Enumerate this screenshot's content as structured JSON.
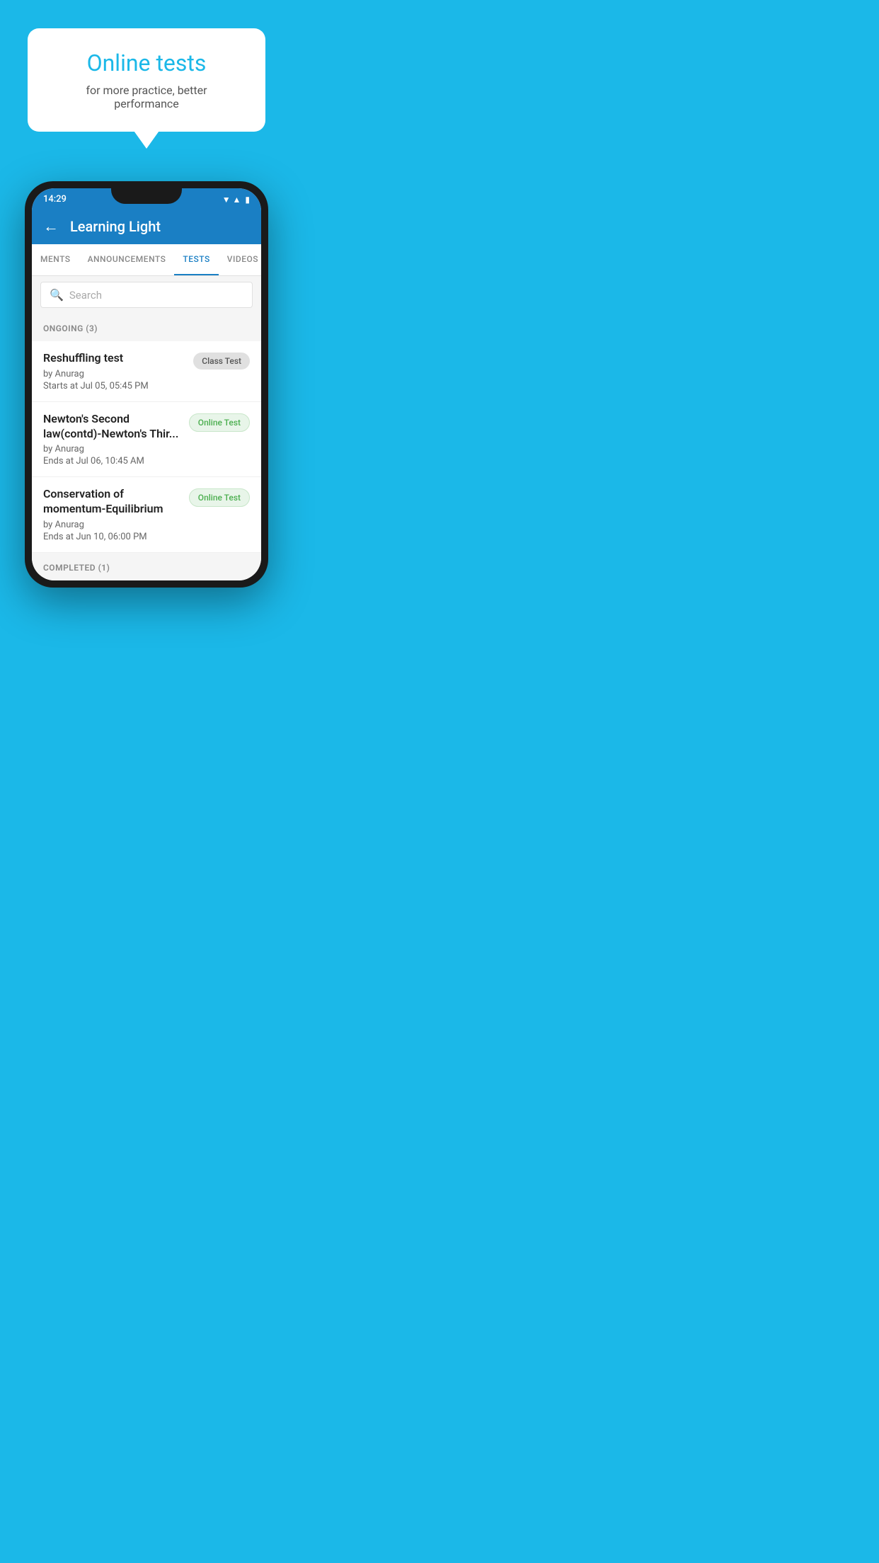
{
  "page": {
    "background_color": "#1BB8E8"
  },
  "bubble": {
    "title": "Online tests",
    "subtitle": "for more practice, better performance"
  },
  "phone": {
    "status_bar": {
      "time": "14:29",
      "wifi": "▲",
      "signal": "▲",
      "battery": "▮"
    },
    "app_bar": {
      "title": "Learning Light",
      "back_label": "←"
    },
    "tabs": [
      {
        "label": "MENTS",
        "active": false
      },
      {
        "label": "ANNOUNCEMENTS",
        "active": false
      },
      {
        "label": "TESTS",
        "active": true
      },
      {
        "label": "VIDEOS",
        "active": false
      }
    ],
    "search": {
      "placeholder": "Search"
    },
    "ongoing_section": {
      "label": "ONGOING (3)",
      "items": [
        {
          "name": "Reshuffling test",
          "author": "by Anurag",
          "date": "Starts at  Jul 05, 05:45 PM",
          "badge": "Class Test",
          "badge_type": "class"
        },
        {
          "name": "Newton's Second law(contd)-Newton's Thir...",
          "author": "by Anurag",
          "date": "Ends at  Jul 06, 10:45 AM",
          "badge": "Online Test",
          "badge_type": "online"
        },
        {
          "name": "Conservation of momentum-Equilibrium",
          "author": "by Anurag",
          "date": "Ends at  Jun 10, 06:00 PM",
          "badge": "Online Test",
          "badge_type": "online"
        }
      ]
    },
    "completed_section": {
      "label": "COMPLETED (1)"
    }
  }
}
